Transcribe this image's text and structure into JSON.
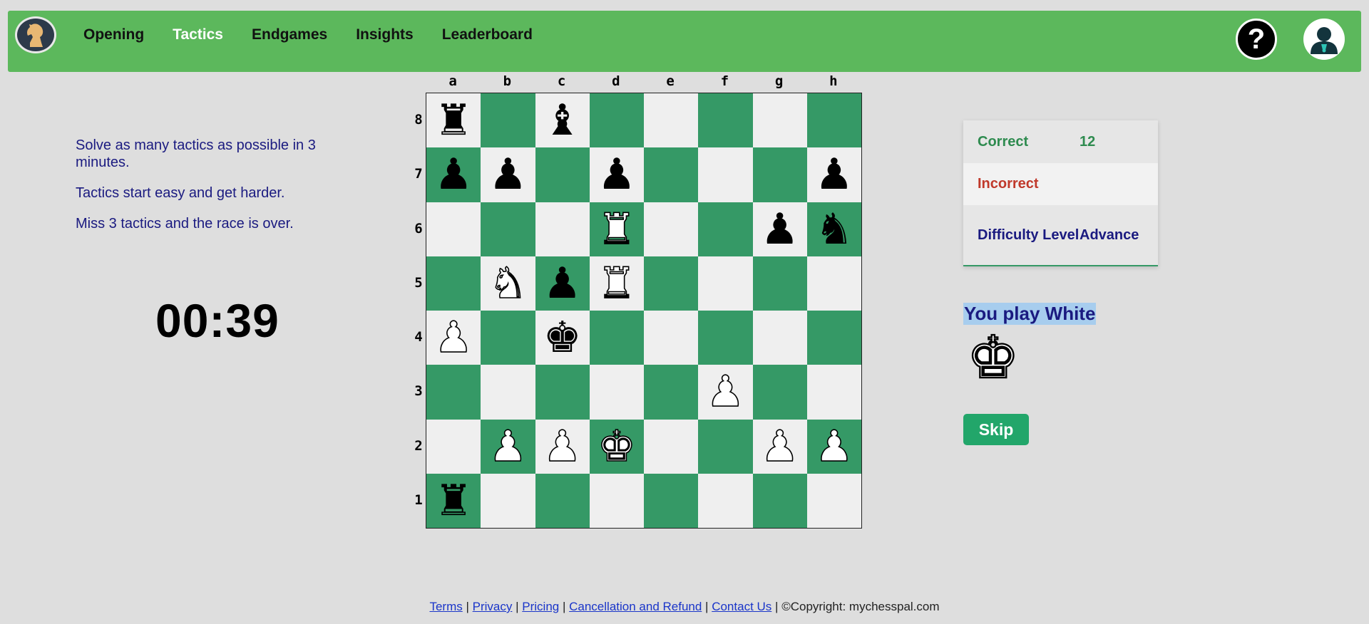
{
  "nav": {
    "items": [
      {
        "label": "Opening",
        "active": false
      },
      {
        "label": "Tactics",
        "active": true
      },
      {
        "label": "Endgames",
        "active": false
      },
      {
        "label": "Insights",
        "active": false
      },
      {
        "label": "Leaderboard",
        "active": false
      }
    ],
    "help_label": "?",
    "colors": {
      "bar": "#5cb85c",
      "active": "#ffffff",
      "inactive": "#111111"
    }
  },
  "info": {
    "lines": [
      "Solve as many tactics as possible in 3 minutes.",
      "Tactics start easy and get harder.",
      "Miss 3 tactics and the race is over."
    ],
    "timer": "00:39"
  },
  "board": {
    "files": [
      "a",
      "b",
      "c",
      "d",
      "e",
      "f",
      "g",
      "h"
    ],
    "ranks": [
      "8",
      "7",
      "6",
      "5",
      "4",
      "3",
      "2",
      "1"
    ],
    "colors": {
      "light": "#efefef",
      "dark": "#359966"
    },
    "position": [
      [
        "bR",
        "",
        "bB",
        "",
        "",
        "",
        "",
        ""
      ],
      [
        "bP",
        "bP",
        "",
        "bP",
        "",
        "",
        "",
        "bP"
      ],
      [
        "",
        "",
        "",
        "wR",
        "",
        "",
        "bP",
        "bN"
      ],
      [
        "",
        "wN",
        "bP",
        "wR",
        "",
        "",
        "",
        ""
      ],
      [
        "wP",
        "",
        "bK",
        "",
        "",
        "",
        "",
        ""
      ],
      [
        "",
        "",
        "",
        "",
        "",
        "wP",
        "",
        ""
      ],
      [
        "",
        "wP",
        "wP",
        "wK",
        "",
        "",
        "wP",
        "wP"
      ],
      [
        "bR",
        "",
        "",
        "",
        "",
        "",
        "",
        ""
      ]
    ]
  },
  "score": {
    "correct_label": "Correct",
    "correct_value": "12",
    "incorrect_label": "Incorrect",
    "incorrect_value": "",
    "difficulty_label": "Difficulty Level",
    "difficulty_value": "Advance"
  },
  "side": {
    "you_play": "You play White",
    "king_icon": "white-king-icon",
    "skip_label": "Skip"
  },
  "footer": {
    "links": [
      "Terms",
      "Privacy",
      "Pricing",
      "Cancellation and Refund",
      "Contact Us"
    ],
    "separator": "|",
    "copyright": "©Copyright: mychesspal.com"
  }
}
